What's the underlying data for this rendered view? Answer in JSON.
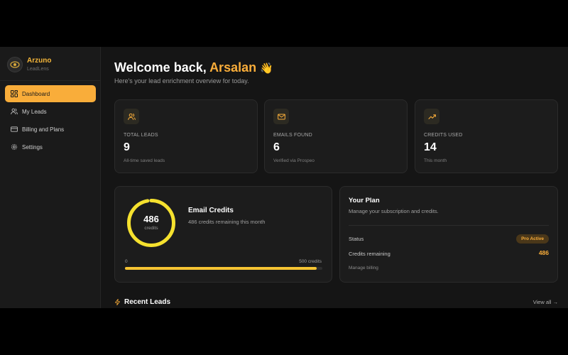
{
  "brand": {
    "name": "Arzuno",
    "product": "LeadLens"
  },
  "nav": [
    {
      "label": "Dashboard",
      "icon": "dashboard-icon",
      "active": true
    },
    {
      "label": "My Leads",
      "icon": "users-icon",
      "active": false
    },
    {
      "label": "Billing and Plans",
      "icon": "credit-card-icon",
      "active": false
    },
    {
      "label": "Settings",
      "icon": "gear-icon",
      "active": false
    }
  ],
  "header": {
    "greeting": "Welcome back, ",
    "user": "Arsalan",
    "wave": "👋",
    "subtitle": "Here's your lead enrichment overview for today."
  },
  "stats": [
    {
      "icon": "users-icon",
      "label": "TOTAL LEADS",
      "value": "9",
      "note": "All-time saved leads"
    },
    {
      "icon": "mail-icon",
      "label": "EMAILS FOUND",
      "value": "6",
      "note": "Verified via Prospeo"
    },
    {
      "icon": "trending-up-icon",
      "label": "CREDITS USED",
      "value": "14",
      "note": "This month"
    }
  ],
  "credits": {
    "remaining": "486",
    "unit": "credits",
    "title": "Email Credits",
    "subtitle": "486 credits remaining this month",
    "bar_min": "0",
    "bar_max": "500 credits",
    "used_fraction": 0.972
  },
  "plan": {
    "title": "Your Plan",
    "subtitle": "Manage your subscription and credits.",
    "status_label": "Status",
    "status_value": "Pro Active",
    "credits_label": "Credits remaining",
    "credits_value": "486",
    "manage_link": "Manage billing"
  },
  "recent": {
    "title": "Recent Leads",
    "view_all": "View all →"
  },
  "colors": {
    "accent": "#f9ad3a",
    "progress": "#f5c432",
    "background": "#151515",
    "card": "#1c1c1c"
  }
}
